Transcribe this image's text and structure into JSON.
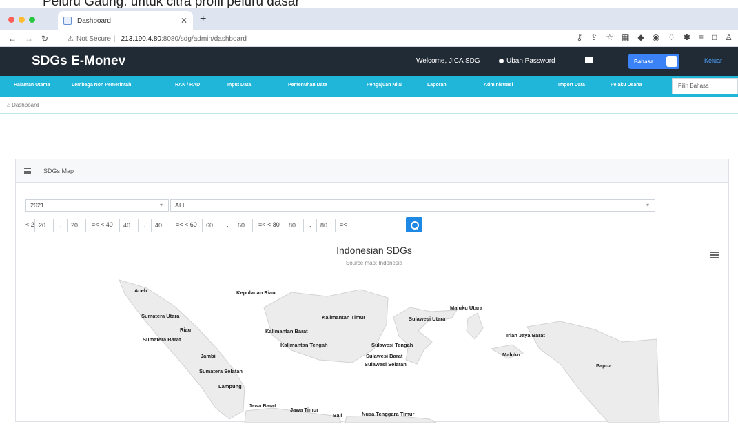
{
  "caption": "Peluru Gaung. untuk citra profil peluru dasar",
  "browser": {
    "tab_title": "Dashboard",
    "url_prefix": "Not Secure",
    "url_host": "213.190.4.80",
    "url_path": ":8080/sdg/admin/dashboard"
  },
  "app": {
    "brand": "SDGs E-Monev",
    "welcome": "Welcome, JICA SDG",
    "change_password": "Ubah Password",
    "language_toggle": "Bahasa",
    "logout": "Keluar"
  },
  "menu": {
    "items": [
      "Halaman Utama",
      "Lembaga Non Pemerintah",
      "RAN / RAD",
      "Input Data",
      "Pemenuhan Data",
      "Pengajuan Nilai",
      "Laporan",
      "Administrasi",
      "Import Data",
      "Pelaku Usaha"
    ],
    "language_placeholder": "Pilih Bahasa"
  },
  "breadcrumb": "Dashboard",
  "panel": {
    "title": "SDGs Map",
    "year": "2021",
    "filter": "ALL",
    "ranges": {
      "lt1": "< 20",
      "r1a": "20",
      "r1b": "20",
      "m1": "=< < 40",
      "r2a": "40",
      "r2b": "40",
      "m2": "=< < 60",
      "r3a": "60",
      "r3b": "60",
      "m3": "=< < 80",
      "r4a": "80",
      "r4b": "80",
      "end": "=<"
    },
    "map_title": "Indonesian SDGs",
    "map_subtitle": "Source map: Indonesia",
    "regions": [
      "Aceh",
      "Kepulauan Riau",
      "Sumatera Utara",
      "Maluku Utara",
      "Kalimantan Timur",
      "Sulawesi Utara",
      "Riau",
      "Kalimantan Barat",
      "Irian Jaya Barat",
      "Sumatera Barat",
      "Kalimantan Tengah",
      "Sulawesi Tengah",
      "Jambi",
      "Sulawesi Barat",
      "Maluku",
      "Sulawesi Selatan",
      "Papua",
      "Sumatera Selatan",
      "Lampung",
      "Jawa Barat",
      "Jawa Timur",
      "Bali",
      "Nusa Tenggara Timur"
    ]
  },
  "colors": {
    "header_bg": "#212b36",
    "menu_bg": "#1fb6d9",
    "accent_blue": "#1e88e5",
    "map_land": "#ececec"
  }
}
